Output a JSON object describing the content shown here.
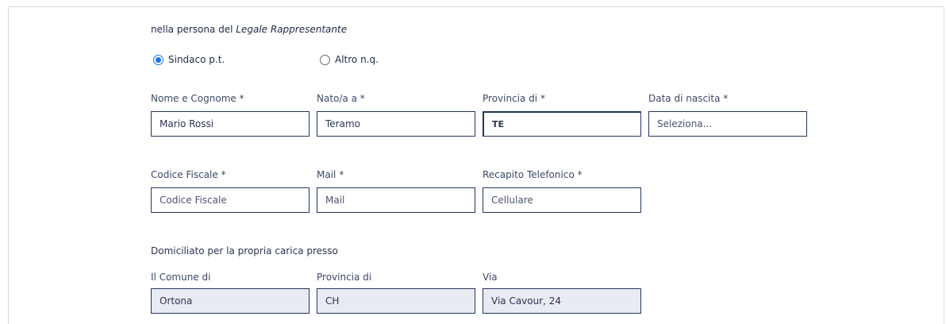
{
  "intro": {
    "prefix": "nella persona del ",
    "role": "Legale Rappresentante"
  },
  "radios": [
    {
      "label": "Sindaco p.t.",
      "checked": true
    },
    {
      "label": "Altro n.q.",
      "checked": false
    }
  ],
  "row1": {
    "nome": {
      "label": "Nome e Cognome *",
      "value": "Mario Rossi"
    },
    "nato": {
      "label": "Nato/a a *",
      "value": "Teramo"
    },
    "provincia": {
      "label": "Provincia di *",
      "value": "TE"
    },
    "data_nascita": {
      "label": "Data di nascita *",
      "placeholder": "Seleziona..."
    }
  },
  "row2": {
    "codice_fiscale": {
      "label": "Codice Fiscale *",
      "placeholder": "Codice Fiscale"
    },
    "mail": {
      "label": "Mail *",
      "placeholder": "Mail"
    },
    "recapito": {
      "label": "Recapito Telefonico *",
      "placeholder": "Cellulare"
    }
  },
  "domicilio": {
    "title": "Domiciliato per la propria carica presso",
    "comune": {
      "label": "Il Comune di",
      "value": "Ortona"
    },
    "provincia": {
      "label": "Provincia di",
      "value": "CH"
    },
    "via": {
      "label": "Via",
      "value": "Via Cavour, 24"
    }
  },
  "colors": {
    "accent": "#1a73e8",
    "field_border": "#24365c",
    "readonly_bg": "#e9ebf3"
  }
}
